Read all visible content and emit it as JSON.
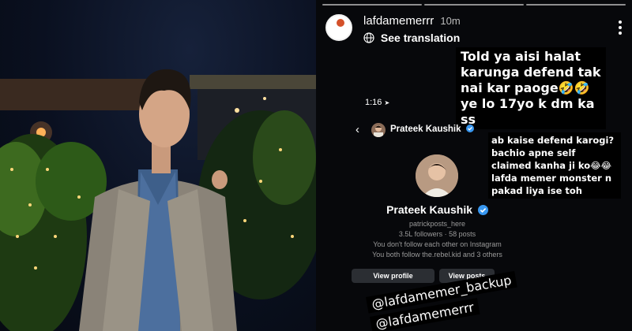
{
  "story": {
    "username": "lafdamemerrr",
    "time": "10m",
    "see_translation": "See translation",
    "avatar_text": "lafda memer"
  },
  "sticker_main": "Told ya aisi halat karunga defend tak nai kar paoge🤣🤣ye lo 17yo k dm ka ss",
  "sticker_side": "ab kaise defend karogi? bachio apne self claimed kanha ji ko😂😂lafda memer monster n pakad liya ise toh",
  "screenshot": {
    "clock": "1:16",
    "header_name": "Prateek Kaushik",
    "profile_name": "Prateek Kaushik",
    "handle": "patrickposts_here",
    "stats": "3.5L followers · 58 posts",
    "not_follow": "You don't follow each other on Instagram",
    "mutual": "You both follow the.rebel.kid and 3 others",
    "view_profile": "View profile",
    "view_other": "View posts"
  },
  "tags": [
    "@lafdamemer_backup",
    "@lafdamemerrr"
  ],
  "colors": {
    "story_bg": "#07080b",
    "verified": "#3897f0",
    "button": "#2b2e33"
  },
  "icons": [
    "three-dots-icon",
    "translate-icon",
    "back-arrow-icon",
    "verified-badge-icon",
    "location-arrow-icon"
  ]
}
